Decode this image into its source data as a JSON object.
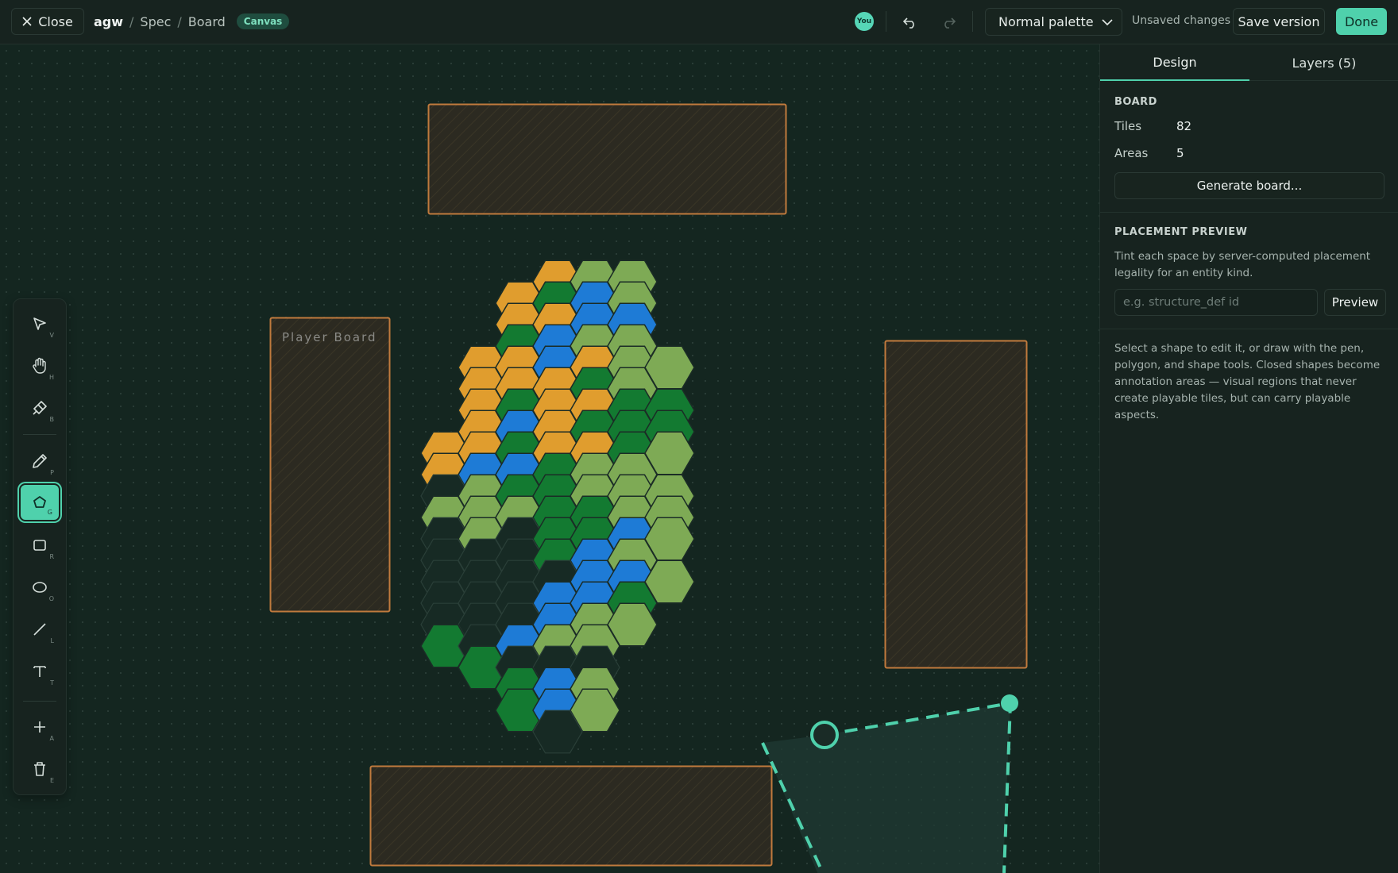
{
  "topbar": {
    "close_label": "Close",
    "breadcrumb": [
      "agw",
      "Spec",
      "Board"
    ],
    "badge": "Canvas",
    "avatar": "You",
    "palette": "Normal palette",
    "status": "Unsaved changes",
    "save_version": "Save version",
    "done": "Done"
  },
  "canvas": {
    "areas": [
      {
        "label": ""
      },
      {
        "label": "Player Board"
      },
      {
        "label": ""
      },
      {
        "label": ""
      }
    ],
    "tile_colors": {
      "O": "#e09d2e",
      "D": "#137a31",
      "B": "#1e7bd6",
      "L": "#7eaa55",
      "E": "#172a24"
    },
    "board_rows": [
      "...OLL.",
      "..ODBL.",
      "..OOBB.",
      "..DBLL.",
      ".OOBOLL",
      ".OOODL.",
      ".ODOODD",
      ".OBODDD",
      "OODOODL",
      "OBBDLL.",
      "ELDDLLL",
      "LLLDDLL",
      "ELEDDBL",
      "EEEDBL.",
      "EEEEBBL",
      "EEEBBD.",
      "EEEBLL.",
      "DEBLL..",
      ".DEEE..",
      "..DBL..",
      "..DBL..",
      "...E..."
    ]
  },
  "toolbar": {
    "tools": [
      {
        "name": "select-tool",
        "icon": "cursor-arrow-icon",
        "key": "V"
      },
      {
        "name": "hand-tool",
        "icon": "hand-icon",
        "key": "H"
      },
      {
        "name": "brush-tool",
        "icon": "brush-icon",
        "key": "B"
      },
      {
        "name": "pen-tool",
        "icon": "pen-icon",
        "key": "P"
      },
      {
        "name": "polygon-tool",
        "icon": "pentagon-icon",
        "key": "G",
        "active": true
      },
      {
        "name": "rectangle-tool",
        "icon": "square-icon",
        "key": "R"
      },
      {
        "name": "ellipse-tool",
        "icon": "ellipse-icon",
        "key": "O"
      },
      {
        "name": "line-tool",
        "icon": "line-icon",
        "key": "L"
      },
      {
        "name": "text-tool",
        "icon": "text-icon",
        "key": "T"
      },
      {
        "name": "add-tool",
        "icon": "plus-icon",
        "key": "A"
      },
      {
        "name": "delete-tool",
        "icon": "trash-icon",
        "key": "E"
      }
    ]
  },
  "panel": {
    "tabs": [
      "Design",
      "Layers (5)"
    ],
    "board": {
      "title": "BOARD",
      "tiles_label": "Tiles",
      "tiles_value": "82",
      "areas_label": "Areas",
      "areas_value": "5",
      "generate": "Generate board..."
    },
    "placement": {
      "title": "PLACEMENT PREVIEW",
      "desc": "Tint each space by server-computed placement legality for an entity kind.",
      "placeholder": "e.g. structure_def id",
      "button": "Preview"
    },
    "help": "Select a shape to edit it, or draw with the pen, polygon, and shape tools. Closed shapes become annotation areas — visual regions that never create playable tiles, but can carry playable aspects."
  },
  "colors": {
    "accent": "#4fd1ac",
    "area_border": "#c07a3d",
    "background": "#142620"
  }
}
